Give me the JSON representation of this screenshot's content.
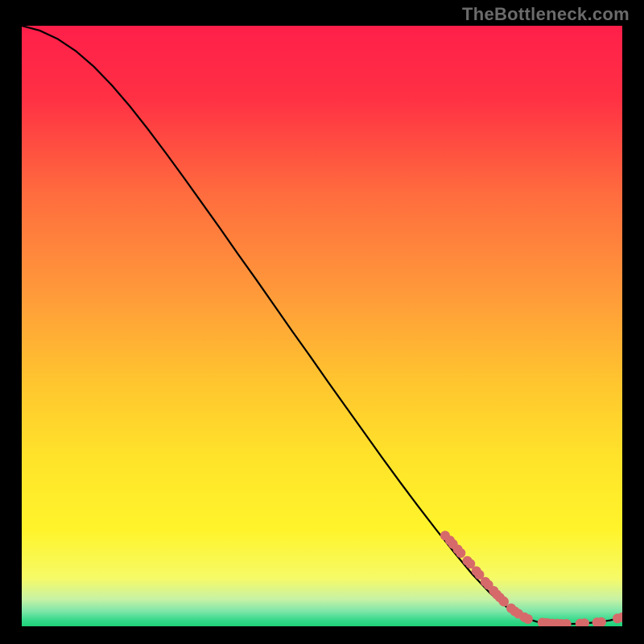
{
  "attribution": "TheBottleneck.com",
  "palette": {
    "bg": "#000000",
    "attribution_text": "#6b6b6b",
    "line": "#000000",
    "dot_fill": "#d66a6a",
    "dot_stroke": "#9c3b3b"
  },
  "chart_data": {
    "type": "line",
    "title": "",
    "xlabel": "",
    "ylabel": "",
    "xlim": [
      0,
      100
    ],
    "ylim": [
      0,
      100
    ],
    "gradient_stops": [
      {
        "offset": 0.0,
        "color": "#ff1f4a"
      },
      {
        "offset": 0.12,
        "color": "#ff3044"
      },
      {
        "offset": 0.28,
        "color": "#ff6c3e"
      },
      {
        "offset": 0.45,
        "color": "#ff9b3a"
      },
      {
        "offset": 0.6,
        "color": "#ffc72e"
      },
      {
        "offset": 0.72,
        "color": "#ffe32a"
      },
      {
        "offset": 0.84,
        "color": "#fff42b"
      },
      {
        "offset": 0.92,
        "color": "#f6fa67"
      },
      {
        "offset": 0.955,
        "color": "#c7f2a5"
      },
      {
        "offset": 0.975,
        "color": "#7ee6a9"
      },
      {
        "offset": 0.99,
        "color": "#35d98a"
      },
      {
        "offset": 1.0,
        "color": "#1ed178"
      }
    ],
    "series": [
      {
        "name": "curve",
        "x": [
          0,
          3,
          6,
          9,
          12,
          15,
          18,
          21,
          24,
          27,
          30,
          33,
          36,
          39,
          42,
          45,
          48,
          51,
          54,
          57,
          60,
          63,
          66,
          69,
          72,
          75,
          78,
          81,
          84,
          86,
          88,
          90,
          92,
          94,
          96,
          98,
          100
        ],
        "y": [
          100,
          99.2,
          97.8,
          95.8,
          93.2,
          90.1,
          86.6,
          82.8,
          78.8,
          74.7,
          70.5,
          66.3,
          62.0,
          57.8,
          53.5,
          49.2,
          45.0,
          40.7,
          36.5,
          32.3,
          28.1,
          24.0,
          20.0,
          16.1,
          12.3,
          8.7,
          5.5,
          3.0,
          1.3,
          0.7,
          0.5,
          0.4,
          0.4,
          0.5,
          0.7,
          1.0,
          1.5
        ]
      }
    ],
    "dots": [
      {
        "x": 70.5,
        "y": 15.1
      },
      {
        "x": 71.3,
        "y": 14.3
      },
      {
        "x": 71.8,
        "y": 13.7
      },
      {
        "x": 72.6,
        "y": 12.8
      },
      {
        "x": 73.1,
        "y": 12.2
      },
      {
        "x": 74.2,
        "y": 10.9
      },
      {
        "x": 74.7,
        "y": 10.4
      },
      {
        "x": 75.7,
        "y": 9.2
      },
      {
        "x": 76.2,
        "y": 8.6
      },
      {
        "x": 77.2,
        "y": 7.4
      },
      {
        "x": 77.7,
        "y": 6.9
      },
      {
        "x": 78.6,
        "y": 5.9
      },
      {
        "x": 79.1,
        "y": 5.3
      },
      {
        "x": 79.6,
        "y": 4.8
      },
      {
        "x": 80.2,
        "y": 4.2
      },
      {
        "x": 80.3,
        "y": 4.1
      },
      {
        "x": 81.5,
        "y": 3.0
      },
      {
        "x": 82.1,
        "y": 2.5
      },
      {
        "x": 82.7,
        "y": 2.1
      },
      {
        "x": 83.7,
        "y": 1.5
      },
      {
        "x": 84.3,
        "y": 1.2
      },
      {
        "x": 86.7,
        "y": 0.6
      },
      {
        "x": 87.3,
        "y": 0.55
      },
      {
        "x": 87.7,
        "y": 0.5
      },
      {
        "x": 88.4,
        "y": 0.45
      },
      {
        "x": 89.2,
        "y": 0.43
      },
      {
        "x": 89.9,
        "y": 0.4
      },
      {
        "x": 90.7,
        "y": 0.4
      },
      {
        "x": 93.0,
        "y": 0.45
      },
      {
        "x": 93.7,
        "y": 0.5
      },
      {
        "x": 95.8,
        "y": 0.65
      },
      {
        "x": 96.5,
        "y": 0.7
      },
      {
        "x": 99.2,
        "y": 1.3
      },
      {
        "x": 100.0,
        "y": 1.5
      }
    ],
    "dot_radius_px": 6
  }
}
